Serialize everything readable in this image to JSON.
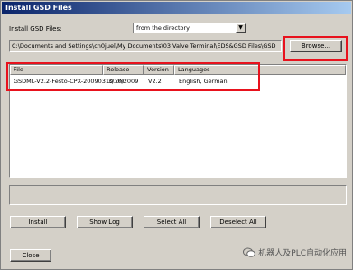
{
  "window": {
    "title": "Install GSD Files"
  },
  "source": {
    "label": "Install GSD Files:",
    "selected": "from the directory"
  },
  "path": {
    "value": "C:\\Documents and Settings\\cn0juel\\My Documents\\03 Valve Terminal\\EDS&GSD Files\\GSD",
    "browse_label": "Browse..."
  },
  "table": {
    "columns": [
      "File",
      "Release",
      "Version",
      "Languages"
    ],
    "rows": [
      {
        "file": "GSDML-V2.2-Festo-CPX-20090310.xml",
        "release": "3/10/2009",
        "version": "V2.2",
        "languages": "English, German"
      }
    ]
  },
  "actions": {
    "install": "Install",
    "show_log": "Show Log",
    "select_all": "Select All",
    "deselect_all": "Deselect All",
    "close": "Close"
  },
  "watermark": {
    "text": "机器人及PLC自动化应用"
  },
  "colors": {
    "highlight": "#e8121d",
    "titlebar": "#0a246a",
    "dialog": "#d4d0c8"
  }
}
